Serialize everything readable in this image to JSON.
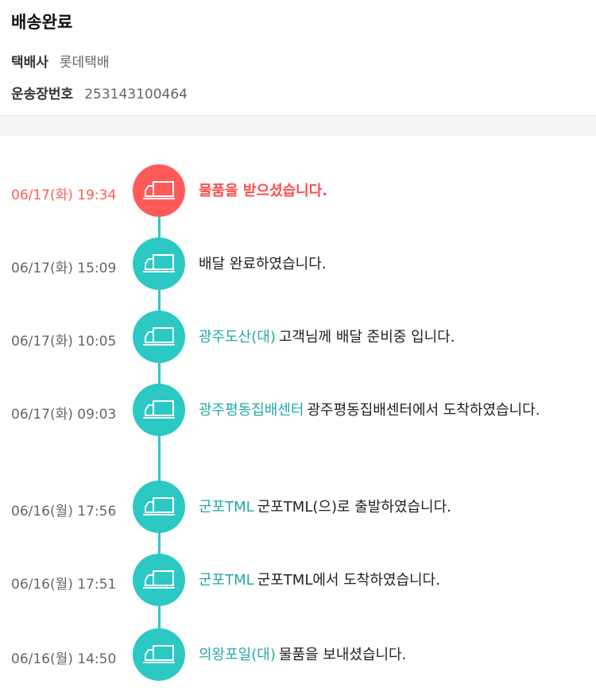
{
  "header": {
    "status": "배송완료",
    "carrier_label": "택배사",
    "carrier_value": "롯데택배",
    "tracking_label": "운송장번호",
    "tracking_value": "253143100464"
  },
  "colors": {
    "accent": "#2cc9c4",
    "active": "#ff5a5a",
    "location_text": "#24a8a5"
  },
  "icons": {
    "event_icon": "truck-icon"
  },
  "events": [
    {
      "time": "06/17(화) 19:34",
      "location": "",
      "message": "물품을 받으셨습니다.",
      "active": true
    },
    {
      "time": "06/17(화) 15:09",
      "location": "",
      "message": "배달 완료하였습니다.",
      "active": false
    },
    {
      "time": "06/17(화) 10:05",
      "location": "광주도산(대)",
      "message": "고객님께 배달 준비중 입니다.",
      "active": false
    },
    {
      "time": "06/17(화) 09:03",
      "location": "광주평동집배센터",
      "message": "광주평동집배센터에서 도착하였습니다.",
      "active": false
    },
    {
      "time": "06/16(월) 17:56",
      "location": "군포TML",
      "message": "군포TML(으)로 출발하였습니다.",
      "active": false
    },
    {
      "time": "06/16(월) 17:51",
      "location": "군포TML",
      "message": "군포TML에서 도착하였습니다.",
      "active": false
    },
    {
      "time": "06/16(월) 14:50",
      "location": "의왕포일(대)",
      "message": "물품을 보내셨습니다.",
      "active": false
    }
  ]
}
